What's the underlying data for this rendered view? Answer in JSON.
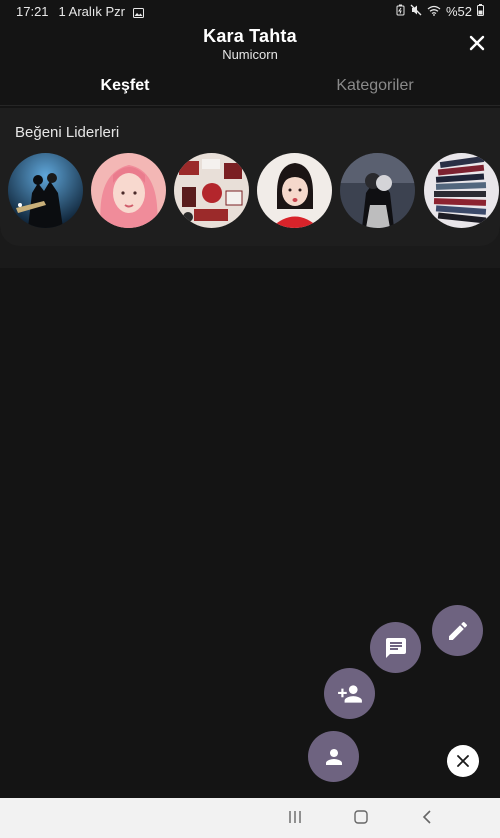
{
  "status_bar": {
    "time": "17:21",
    "date": "1 Aralık Pzr",
    "battery": "%52"
  },
  "header": {
    "title": "Kara Tahta",
    "subtitle": "Numicorn"
  },
  "tabs": [
    {
      "label": "Keşfet",
      "active": true
    },
    {
      "label": "Kategoriler",
      "active": false
    }
  ],
  "leaders": {
    "title": "Beğeni Liderleri",
    "avatars": [
      {
        "name": "avatar-concert"
      },
      {
        "name": "avatar-pink-hair"
      },
      {
        "name": "avatar-sticker-collage"
      },
      {
        "name": "avatar-girl-red-shirt"
      },
      {
        "name": "avatar-couple-bw"
      },
      {
        "name": "avatar-book-stack"
      }
    ]
  },
  "fab_actions": [
    {
      "icon": "pencil-icon"
    },
    {
      "icon": "chat-icon"
    },
    {
      "icon": "add-person-icon"
    },
    {
      "icon": "person-icon"
    }
  ],
  "colors": {
    "background": "#141414",
    "section": "#1e1e1e",
    "fab": "#6e6380",
    "nav_bar": "#f2f2f2"
  }
}
